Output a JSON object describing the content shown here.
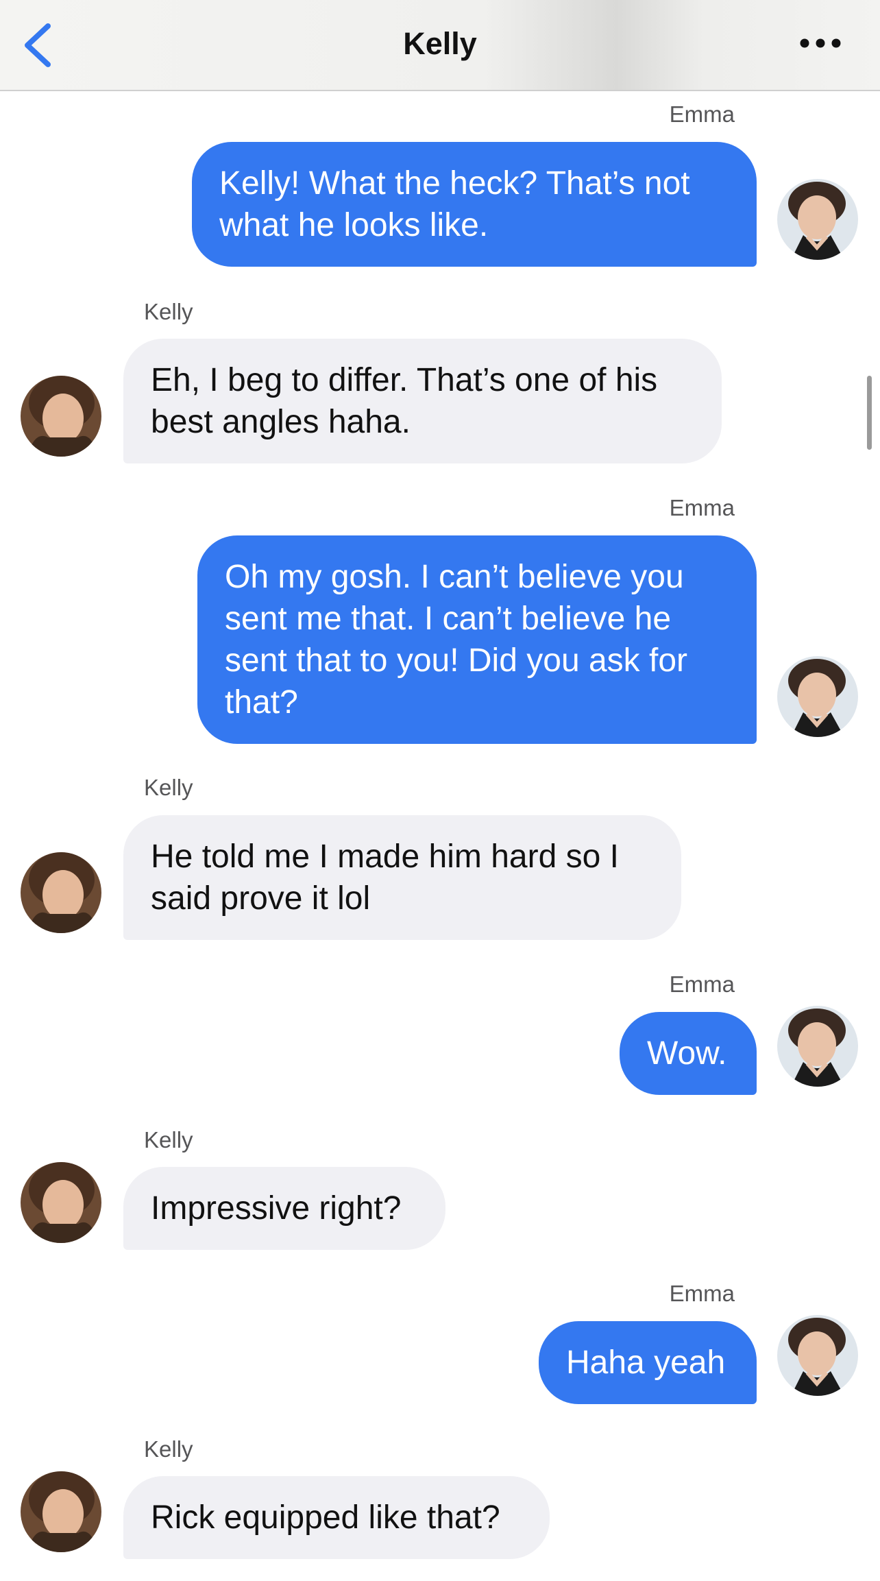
{
  "header": {
    "title": "Kelly",
    "back_icon": "chevron-left-icon",
    "more_icon": "ellipsis-icon"
  },
  "colors": {
    "outgoing_bubble": "#3478f0",
    "incoming_bubble": "#f0f0f4",
    "accent": "#3478f0"
  },
  "messages": [
    {
      "sender": "Emma",
      "text": "Kelly! What the heck? That’s not what he looks like.",
      "direction": "outgoing"
    },
    {
      "sender": "Kelly",
      "text": "Eh, I beg to differ. That’s one of his best angles haha.",
      "direction": "incoming"
    },
    {
      "sender": "Emma",
      "text": "Oh my gosh. I can’t believe you sent me that. I can’t believe he sent that to you! Did you ask for that?",
      "direction": "outgoing"
    },
    {
      "sender": "Kelly",
      "text": "He told me I made him hard so I said prove it lol",
      "direction": "incoming"
    },
    {
      "sender": "Emma",
      "text": "Wow.",
      "direction": "outgoing"
    },
    {
      "sender": "Kelly",
      "text": "Impressive right?",
      "direction": "incoming"
    },
    {
      "sender": "Emma",
      "text": "Haha yeah",
      "direction": "outgoing"
    },
    {
      "sender": "Kelly",
      "text": "Rick equipped like that?",
      "direction": "incoming"
    }
  ]
}
